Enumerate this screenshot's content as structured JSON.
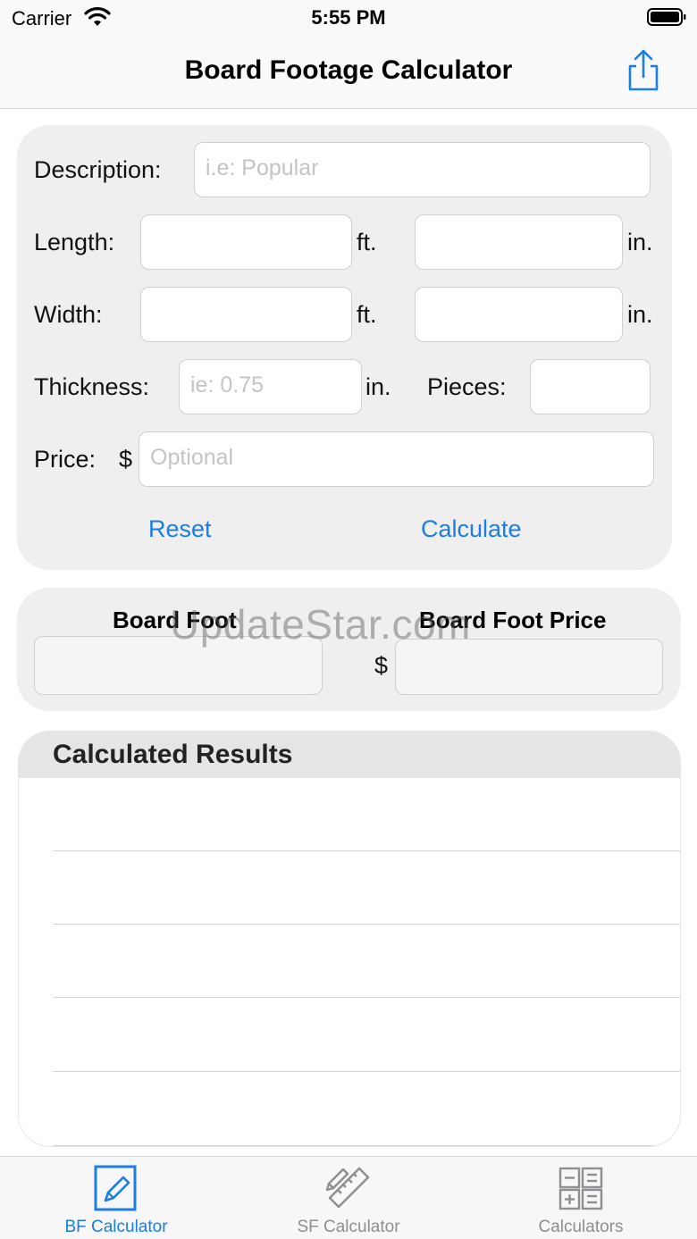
{
  "status_bar": {
    "carrier": "Carrier",
    "time": "5:55 PM"
  },
  "nav": {
    "title": "Board Footage Calculator",
    "share_icon": "share-icon"
  },
  "form": {
    "description": {
      "label": "Description:",
      "placeholder": "i.e: Popular",
      "value": ""
    },
    "length": {
      "label": "Length:",
      "unit_ft": "ft.",
      "unit_in": "in.",
      "ft_value": "",
      "in_value": ""
    },
    "width": {
      "label": "Width:",
      "unit_ft": "ft.",
      "unit_in": "in.",
      "ft_value": "",
      "in_value": ""
    },
    "thickness": {
      "label": "Thickness:",
      "placeholder": "ie: 0.75",
      "unit": "in.",
      "value": ""
    },
    "pieces": {
      "label": "Pieces:",
      "value": ""
    },
    "price": {
      "label": "Price:",
      "currency": "$",
      "placeholder": "Optional",
      "value": ""
    },
    "reset_label": "Reset",
    "calculate_label": "Calculate"
  },
  "output": {
    "board_foot_label": "Board Foot",
    "board_foot_value": "",
    "board_foot_price_label": "Board Foot Price",
    "currency": "$",
    "board_foot_price_value": ""
  },
  "watermark": "UpdateStar.com",
  "results": {
    "title": "Calculated Results",
    "rows": [
      "",
      "",
      "",
      "",
      ""
    ]
  },
  "tabs": [
    {
      "label": "BF Calculator",
      "icon": "pencil-icon",
      "active": true
    },
    {
      "label": "SF Calculator",
      "icon": "ruler-pencil-icon",
      "active": false
    },
    {
      "label": "Calculators",
      "icon": "calculator-icon",
      "active": false
    }
  ],
  "colors": {
    "accent": "#1a7ee6",
    "card_background": "#efeff0",
    "inactive_tab": "#8e8e93"
  }
}
